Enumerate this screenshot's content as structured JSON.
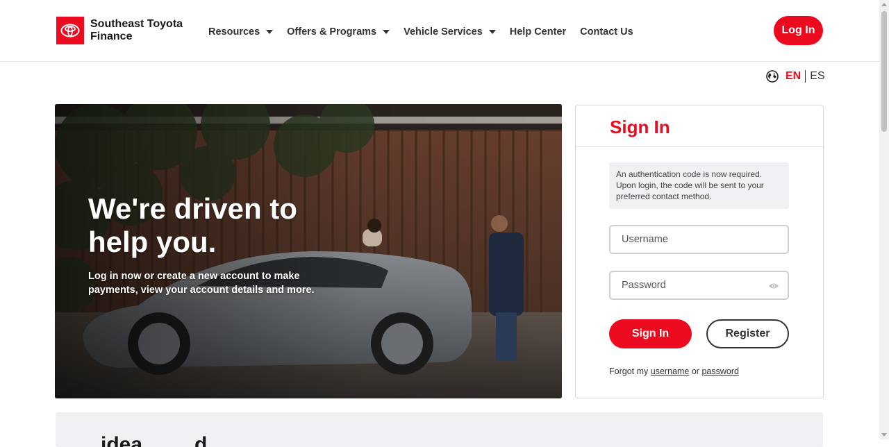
{
  "brand": {
    "name_line1": "Southeast Toyota",
    "name_line2": "Finance",
    "logo_icon": "toyota-logo-icon",
    "accent_color": "#eb0a1e"
  },
  "nav": {
    "items": [
      {
        "label": "Resources",
        "has_dropdown": true
      },
      {
        "label": "Offers & Programs",
        "has_dropdown": true
      },
      {
        "label": "Vehicle Services",
        "has_dropdown": true
      },
      {
        "label": "Help Center",
        "has_dropdown": false
      },
      {
        "label": "Contact Us",
        "has_dropdown": false
      }
    ],
    "login_label": "Log In"
  },
  "language": {
    "icon": "globe-icon",
    "active": "EN",
    "other": "ES"
  },
  "hero": {
    "title": "We're driven to help you.",
    "subtitle": "Log in now or create a new account to make payments, view your account details and more."
  },
  "signin": {
    "title": "Sign In",
    "notice": "An authentication code is now required. Upon login, the code will be sent to your preferred contact method.",
    "username_placeholder": "Username",
    "password_placeholder": "Password",
    "password_toggle_icon": "eye-icon",
    "signin_label": "Sign In",
    "register_label": "Register",
    "forgot_prefix": "Forgot my",
    "forgot_username": "username",
    "forgot_or": "or",
    "forgot_password": "password"
  },
  "bottom": {
    "heading_partial": "...idea.........d"
  }
}
